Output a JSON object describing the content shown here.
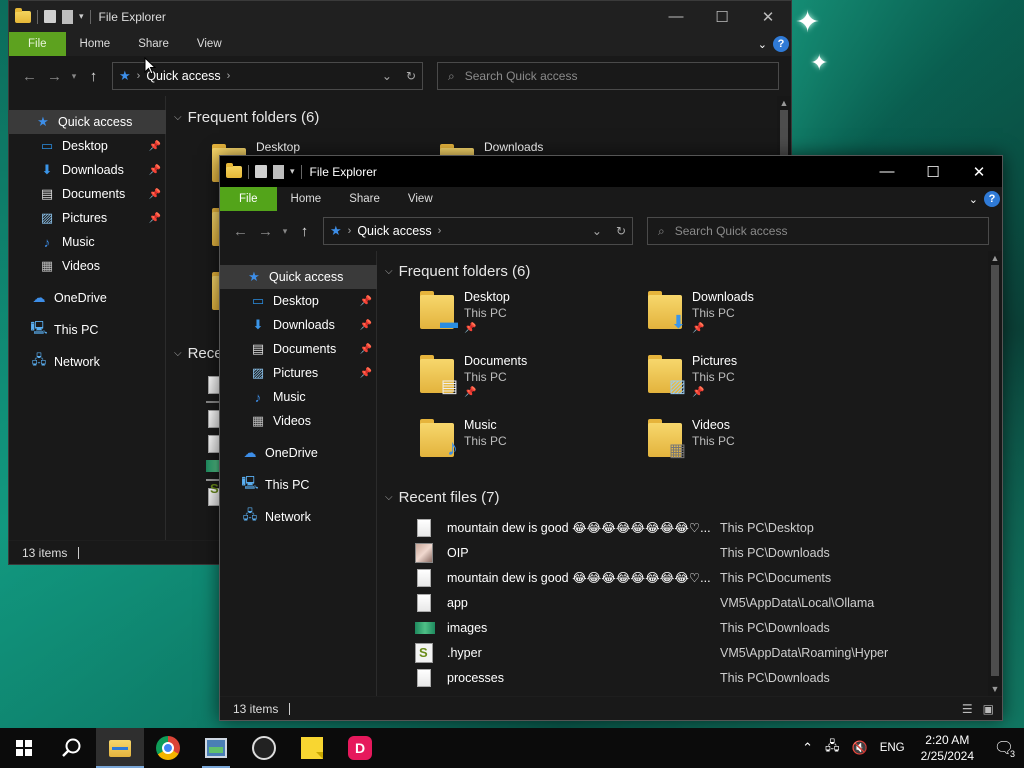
{
  "window_back": {
    "title": "File Explorer",
    "ribbon": [
      "File",
      "Home",
      "Share",
      "View"
    ],
    "address_crumb": "Quick access",
    "search_placeholder": "Search Quick access",
    "frequent_header": "Frequent folders (6)",
    "recent_header": "Rece",
    "visible_folders": [
      "Desktop",
      "Downloads"
    ],
    "nav": [
      "Quick access",
      "Desktop",
      "Downloads",
      "Documents",
      "Pictures",
      "Music",
      "Videos",
      "OneDrive",
      "This PC",
      "Network"
    ],
    "status": "13 items"
  },
  "window_front": {
    "title": "File Explorer",
    "ribbon": [
      "File",
      "Home",
      "Share",
      "View"
    ],
    "address_crumb": "Quick access",
    "search_placeholder": "Search Quick access",
    "frequent_header": "Frequent folders (6)",
    "recent_header": "Recent files (7)",
    "nav": [
      {
        "label": "Quick access",
        "icon": "star-icon",
        "pinned": false,
        "selected": true
      },
      {
        "label": "Desktop",
        "icon": "desktop-icon",
        "pinned": true
      },
      {
        "label": "Downloads",
        "icon": "download-icon",
        "pinned": true
      },
      {
        "label": "Documents",
        "icon": "documents-icon",
        "pinned": true
      },
      {
        "label": "Pictures",
        "icon": "pictures-icon",
        "pinned": true
      },
      {
        "label": "Music",
        "icon": "music-icon",
        "pinned": false
      },
      {
        "label": "Videos",
        "icon": "videos-icon",
        "pinned": false
      },
      {
        "label": "OneDrive",
        "icon": "cloud-icon",
        "pinned": false
      },
      {
        "label": "This PC",
        "icon": "computer-icon",
        "pinned": false
      },
      {
        "label": "Network",
        "icon": "network-icon",
        "pinned": false
      }
    ],
    "folders": [
      {
        "name": "Desktop",
        "location": "This PC",
        "pinned": true,
        "overlay": "desktop-icon"
      },
      {
        "name": "Downloads",
        "location": "This PC",
        "pinned": true,
        "overlay": "download-icon"
      },
      {
        "name": "Documents",
        "location": "This PC",
        "pinned": true,
        "overlay": "documents-icon"
      },
      {
        "name": "Pictures",
        "location": "This PC",
        "pinned": true,
        "overlay": "pictures-icon"
      },
      {
        "name": "Music",
        "location": "This PC",
        "pinned": false,
        "overlay": "music-icon"
      },
      {
        "name": "Videos",
        "location": "This PC",
        "pinned": false,
        "overlay": "videos-icon"
      }
    ],
    "recent_files": [
      {
        "name": "mountain dew is good 😂😂😂😂😂😂😂😂♡...",
        "location": "This PC\\Desktop",
        "icon": "doc"
      },
      {
        "name": "OIP",
        "location": "This PC\\Downloads",
        "icon": "img"
      },
      {
        "name": "mountain dew is good 😂😂😂😂😂😂😂😂♡...",
        "location": "This PC\\Documents",
        "icon": "doc"
      },
      {
        "name": "app",
        "location": "VM5\\AppData\\Local\\Ollama",
        "icon": "doc"
      },
      {
        "name": "images",
        "location": "This PC\\Downloads",
        "icon": "pic"
      },
      {
        "name": ".hyper",
        "location": "VM5\\AppData\\Roaming\\Hyper",
        "icon": "hyp"
      },
      {
        "name": "processes",
        "location": "This PC\\Downloads",
        "icon": "doc"
      }
    ],
    "status": "13 items"
  },
  "taskbar": {
    "apps": [
      "start-icon",
      "search-icon",
      "file-explorer-icon",
      "chrome-icon",
      "task-manager-icon",
      "obs-icon",
      "sticky-notes-icon",
      "davinci-icon"
    ],
    "language": "ENG",
    "time": "2:20 AM",
    "date": "2/25/2024",
    "notifications": "3"
  },
  "colors": {
    "file_tab": "#53a41a",
    "accent": "#3d8ee8",
    "window_bg": "#191919"
  }
}
